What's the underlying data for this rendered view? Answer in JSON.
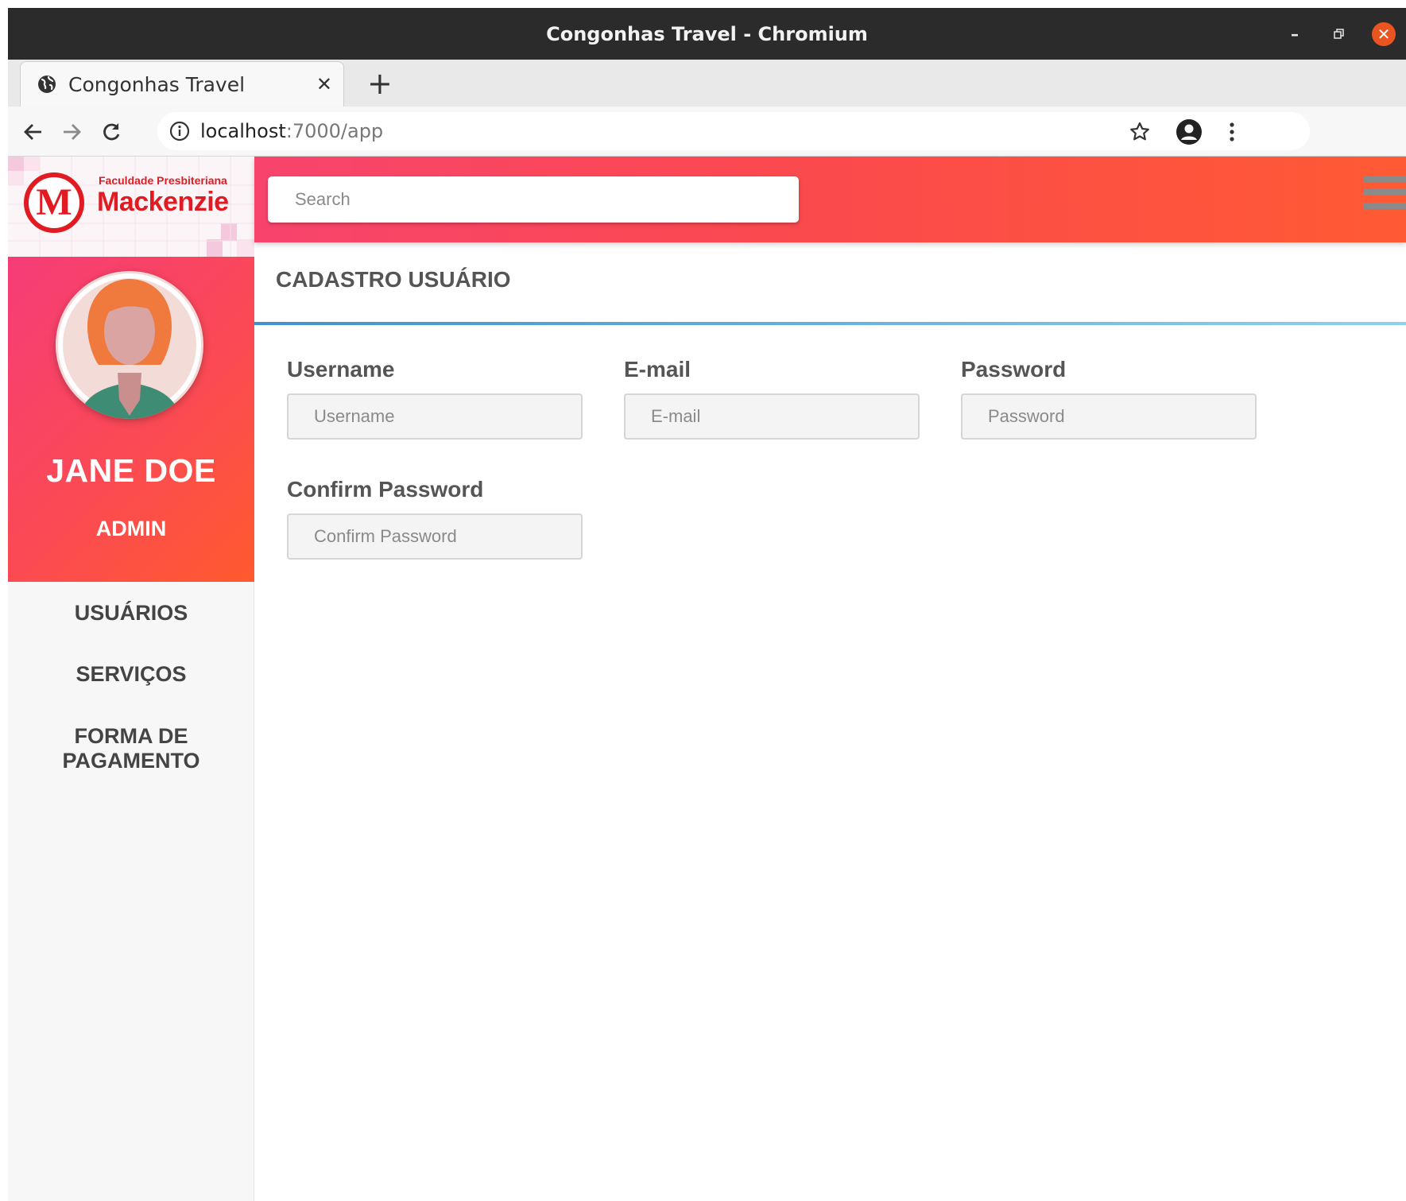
{
  "window": {
    "title": "Congonhas Travel - Chromium",
    "controls": [
      "minimize-icon",
      "restore-icon",
      "close-icon"
    ]
  },
  "browser": {
    "tab_title": "Congonhas Travel",
    "new_tab_label": "+",
    "url_host": "localhost",
    "url_path": ":7000/app"
  },
  "brand": {
    "logo_small": "Faculdade Presbiteriana",
    "logo_big": "Mackenzie",
    "logo_letter": "M",
    "accent_color": "#fb4a54"
  },
  "profile": {
    "name": "JANE DOE",
    "role": "ADMIN"
  },
  "menu": {
    "items": [
      {
        "label": "USUÁRIOS"
      },
      {
        "label": "SERVIÇOS"
      },
      {
        "label": "FORMA DE PAGAMENTO"
      }
    ]
  },
  "search": {
    "placeholder": "Search"
  },
  "page": {
    "title": "CADASTRO USUÁRIO"
  },
  "form": {
    "username": {
      "label": "Username",
      "placeholder": "Username",
      "value": ""
    },
    "email": {
      "label": "E-mail",
      "placeholder": "E-mail",
      "value": ""
    },
    "password": {
      "label": "Password",
      "placeholder": "Password",
      "value": ""
    },
    "confirm_password": {
      "label": "Confirm Password",
      "placeholder": "Confirm Password",
      "value": ""
    }
  }
}
